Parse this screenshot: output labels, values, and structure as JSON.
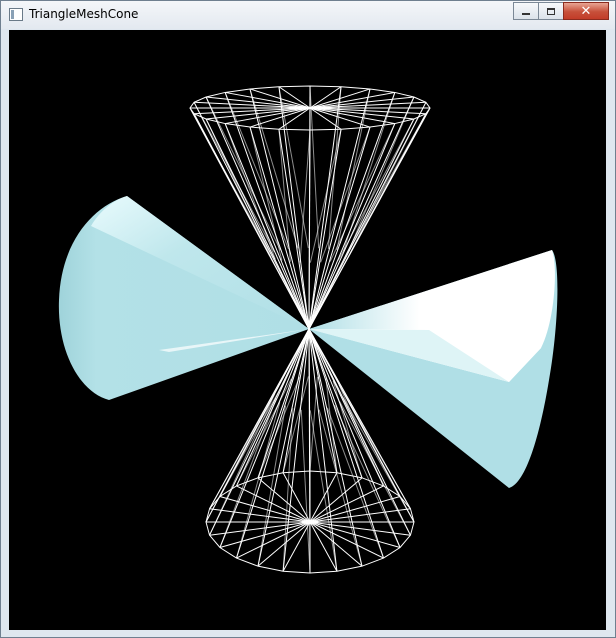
{
  "window": {
    "title": "TriangleMeshCone",
    "icon": "application-window-icon",
    "buttons": {
      "minimize": "minimize-icon",
      "maximize": "maximize-icon",
      "close": "close-icon",
      "close_glyph": "✕"
    }
  },
  "scene": {
    "background": "#000000",
    "wire_color": "#ffffff",
    "solid_color": "#b0dfe6",
    "highlight_color": "#ffffff",
    "objects": [
      "wireframe-cone-top",
      "wireframe-cone-bottom",
      "solid-cone-left",
      "solid-cone-right"
    ]
  }
}
